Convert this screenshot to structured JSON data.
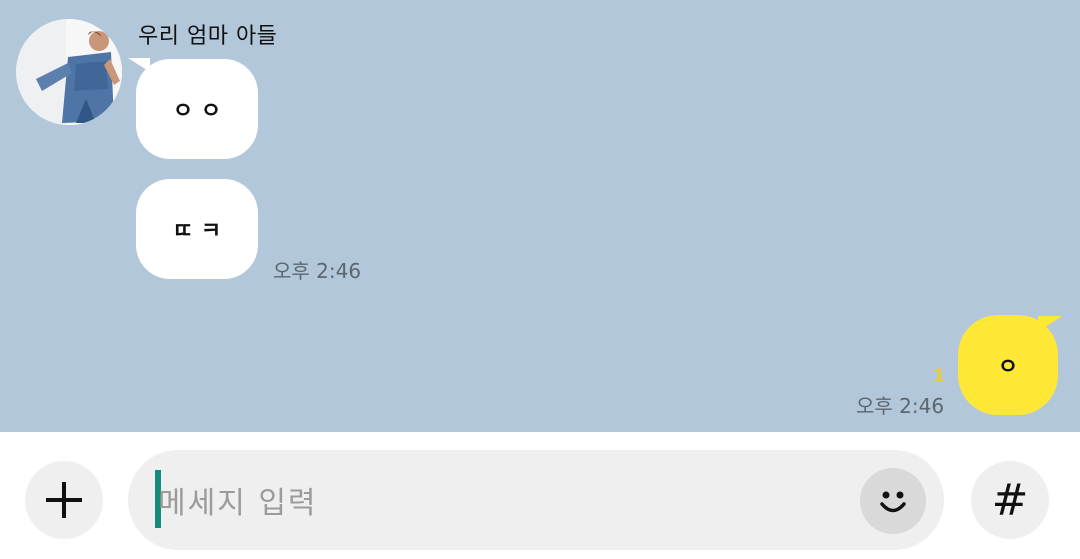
{
  "chat": {
    "sender_name": "우리 엄마 아들",
    "incoming": [
      {
        "text": "ㅇ ㅇ"
      },
      {
        "text": "ㄸ ㅋ"
      }
    ],
    "incoming_time": "오후 2:46",
    "outgoing": {
      "text": "ㅇ",
      "unread_count": "1",
      "time": "오후 2:46"
    },
    "background_color": "#b2c7da",
    "outgoing_bubble_color": "#fee735"
  },
  "composer": {
    "placeholder": "메세지 입력",
    "add_icon": "plus-icon",
    "emoji_icon": "smiley-icon",
    "hashtag_label": "#"
  }
}
